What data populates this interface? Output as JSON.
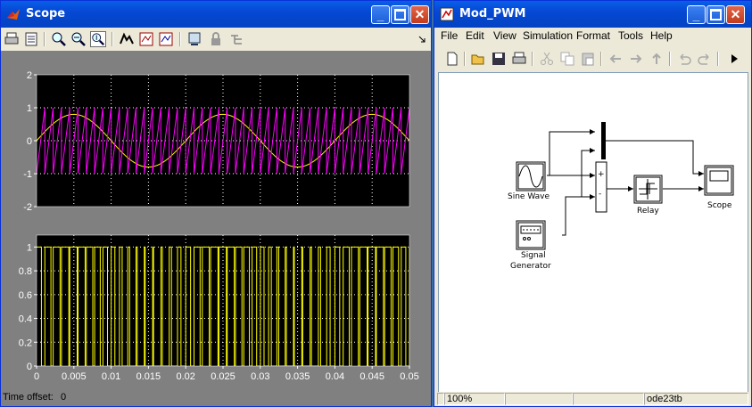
{
  "scope": {
    "title": "Scope",
    "time_offset_label": "Time offset:",
    "time_offset_value": "0",
    "toolbar": [
      "print-icon",
      "parameters-icon",
      "zoom-icon",
      "zoom-x-icon",
      "zoom-y-icon",
      "autoscale-icon",
      "save-axes-icon",
      "restore-axes-icon",
      "floating-scope-icon",
      "lock-axes-icon",
      "signal-selection-icon"
    ],
    "colors": {
      "background": "#7f7f7f",
      "axes": "#000000",
      "sine": "#ffff00",
      "carrier": "#ff00ff",
      "pwm": "#ffff00"
    },
    "chart_data": [
      {
        "type": "line",
        "title": "",
        "xlim": [
          0,
          0.05
        ],
        "ylim": [
          -2,
          2
        ],
        "yticks": [
          "2",
          "1",
          "0",
          "-1",
          "-2"
        ],
        "grid": true,
        "series": [
          {
            "kind": "sine",
            "amplitude": 0.8,
            "frequency_hz": 50,
            "color": "#ffff00"
          },
          {
            "kind": "sawtooth",
            "amplitude": 1,
            "frequency_hz": 900,
            "color": "#ff00ff"
          }
        ]
      },
      {
        "type": "line",
        "title": "",
        "xlim": [
          0,
          0.05
        ],
        "ylim": [
          0,
          1.1
        ],
        "yticks": [
          "1",
          "0.8",
          "0.6",
          "0.4",
          "0.2",
          "0"
        ],
        "xticks": [
          "0",
          "0.005",
          "0.01",
          "0.015",
          "0.02",
          "0.025",
          "0.03",
          "0.035",
          "0.04",
          "0.045",
          "0.05"
        ],
        "grid": true,
        "series": [
          {
            "kind": "pwm",
            "low": 0,
            "high": 1,
            "color": "#ffff00"
          }
        ]
      }
    ]
  },
  "model": {
    "title": "Mod_PWM",
    "menu": [
      "File",
      "Edit",
      "View",
      "Simulation",
      "Format",
      "Tools",
      "Help"
    ],
    "toolbar": [
      "new-icon",
      "open-icon",
      "save-icon",
      "print-icon",
      "cut-icon",
      "copy-icon",
      "paste-icon",
      "back-icon",
      "forward-icon",
      "up-icon",
      "undo-icon",
      "redo-icon",
      "run-icon"
    ],
    "blocks": {
      "sine": "Sine Wave",
      "siggen_line1": "Signal",
      "siggen_line2": "Generator",
      "relay": "Relay",
      "scope": "Scope",
      "sum_plus": "+",
      "sum_minus": "-"
    },
    "status": {
      "cell1": "",
      "zoom": "100%",
      "cell3": "",
      "cell4": "",
      "solver": "ode23tb"
    }
  }
}
